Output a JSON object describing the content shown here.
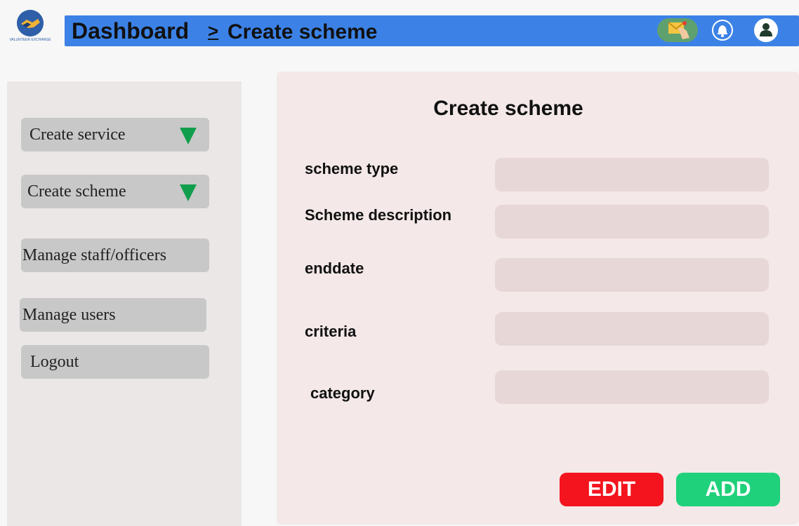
{
  "header": {
    "logo_caption": "VALUNTEER EXCHANGE",
    "breadcrumb": {
      "root": "Dashboard",
      "separator": ">",
      "current": "Create scheme"
    },
    "icons": [
      "mail-icon",
      "bell-icon",
      "user-icon"
    ],
    "bar_color": "#3c82e6"
  },
  "sidebar": {
    "items": [
      {
        "label": "Create service",
        "has_dropdown": true
      },
      {
        "label": "Create scheme",
        "has_dropdown": true
      },
      {
        "label": "Manage staff/officers",
        "has_dropdown": false
      },
      {
        "label": "Manage users",
        "has_dropdown": false
      },
      {
        "label": "Logout",
        "has_dropdown": false
      }
    ],
    "dropdown_icon_color": "#119e4c"
  },
  "form": {
    "title": "Create scheme",
    "fields": [
      {
        "label": "scheme type",
        "value": ""
      },
      {
        "label": "Scheme description",
        "value": ""
      },
      {
        "label": "enddate",
        "value": ""
      },
      {
        "label": "criteria",
        "value": ""
      },
      {
        "label": "category",
        "value": ""
      }
    ],
    "buttons": {
      "edit_label": "EDIT",
      "add_label": "ADD",
      "edit_color": "#f3141d",
      "add_color": "#1fd17a"
    }
  }
}
